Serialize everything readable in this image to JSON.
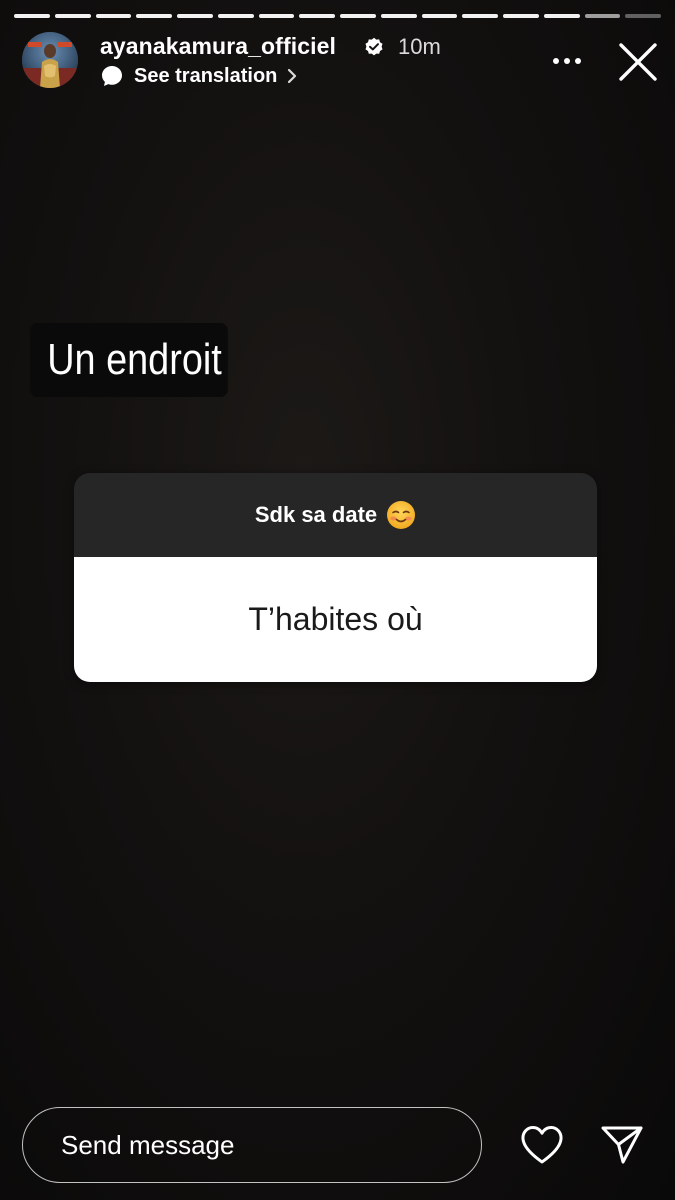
{
  "story": {
    "progress": {
      "total_segments": 16,
      "current_index": 14
    },
    "header": {
      "username": "ayanakamura_officiel",
      "verified": true,
      "time": "10m",
      "translation_label": "See translation",
      "icons": [
        "verified-badge-icon",
        "translate-bubble-icon",
        "chevron-right-icon",
        "more-options-icon",
        "close-icon"
      ]
    },
    "answer_text": "Un endroit",
    "question_sticker": {
      "header_text": "Sdk sa date",
      "header_emoji": "smiling-face-icon",
      "question_text": "T’habites où"
    },
    "footer": {
      "message_placeholder": "Send message",
      "icons": [
        "heart-icon",
        "send-icon"
      ]
    }
  },
  "colors": {
    "background": "#131110",
    "sticker_header": "#262626",
    "sticker_body": "#ffffff",
    "text": "#ffffff"
  }
}
